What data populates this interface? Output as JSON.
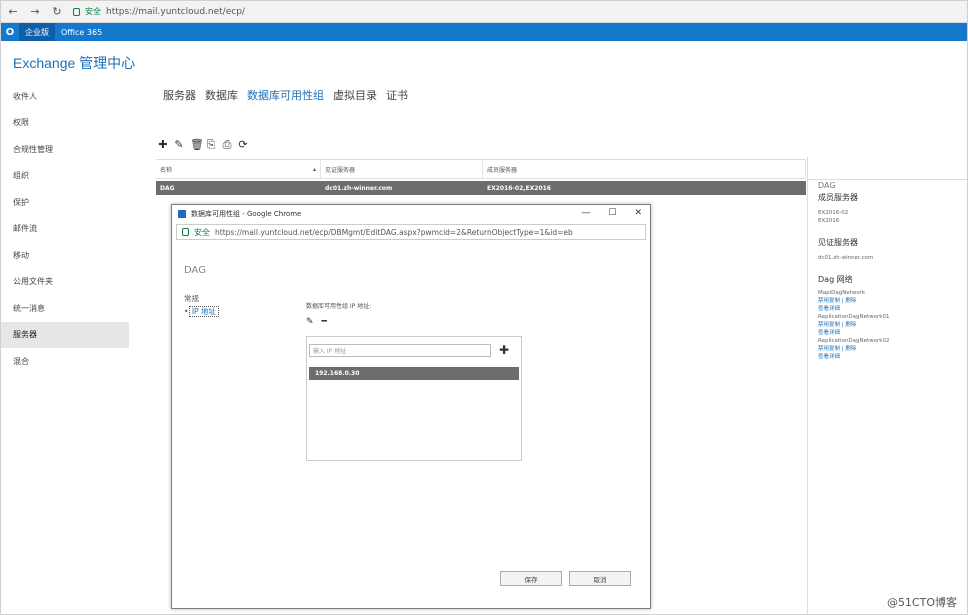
{
  "browser": {
    "secure_label": "安全",
    "url": "https://mail.yuntcloud.net/ecp/"
  },
  "o365": {
    "items": [
      "企业版",
      "Office 365"
    ]
  },
  "app": {
    "title": "Exchange 管理中心"
  },
  "leftnav": {
    "items": [
      "收件人",
      "权限",
      "合规性管理",
      "组织",
      "保护",
      "邮件流",
      "移动",
      "公用文件夹",
      "统一消息",
      "服务器",
      "混合"
    ],
    "active_index": 9
  },
  "tabs": {
    "items": [
      "服务器",
      "数据库",
      "数据库可用性组",
      "虚拟目录",
      "证书"
    ],
    "active_index": 2
  },
  "toolbar": {
    "icons": [
      "add-icon",
      "edit-icon",
      "delete-icon",
      "manage-membership-icon",
      "configure-network-icon",
      "refresh-icon"
    ]
  },
  "grid": {
    "headers": [
      "名称",
      "见证服务器",
      "成员服务器"
    ],
    "rows": [
      [
        "DAG",
        "dc01.zh-winner.com",
        "EX2016-02,EX2016"
      ]
    ]
  },
  "details": {
    "title": "DAG",
    "members_heading": "成员服务器",
    "members": [
      "EX2016-02",
      "EX2016"
    ],
    "witness_heading": "见证服务器",
    "witness": "dc01.zh-winner.com",
    "network_heading": "Dag 网络",
    "networks": [
      {
        "name": "MapiDagNetwork",
        "links": [
          "禁用复制 | 删除",
          "查看详细"
        ]
      },
      {
        "name": "ReplicationDagNetwork01",
        "links": [
          "禁用复制 | 删除",
          "查看详细"
        ]
      },
      {
        "name": "ReplicationDagNetwork02",
        "links": [
          "禁用复制 | 删除",
          "查看详细"
        ]
      }
    ]
  },
  "popup": {
    "title": "数据库可用性组 - Google Chrome",
    "secure_label": "安全",
    "url": "https://mail.yuntcloud.net/ecp/DBMgmt/EditDAG.aspx?pwmcid=2&ReturnObjectType=1&id=eb",
    "heading": "DAG",
    "nav": [
      "常规",
      "IP 地址"
    ],
    "ip_label": "数据库可用性组 IP 地址:",
    "ip_placeholder": "输入 IP 地址",
    "ip_list": [
      "192.168.0.30"
    ],
    "save_label": "保存",
    "cancel_label": "取消"
  },
  "watermark": "@51CTO博客"
}
